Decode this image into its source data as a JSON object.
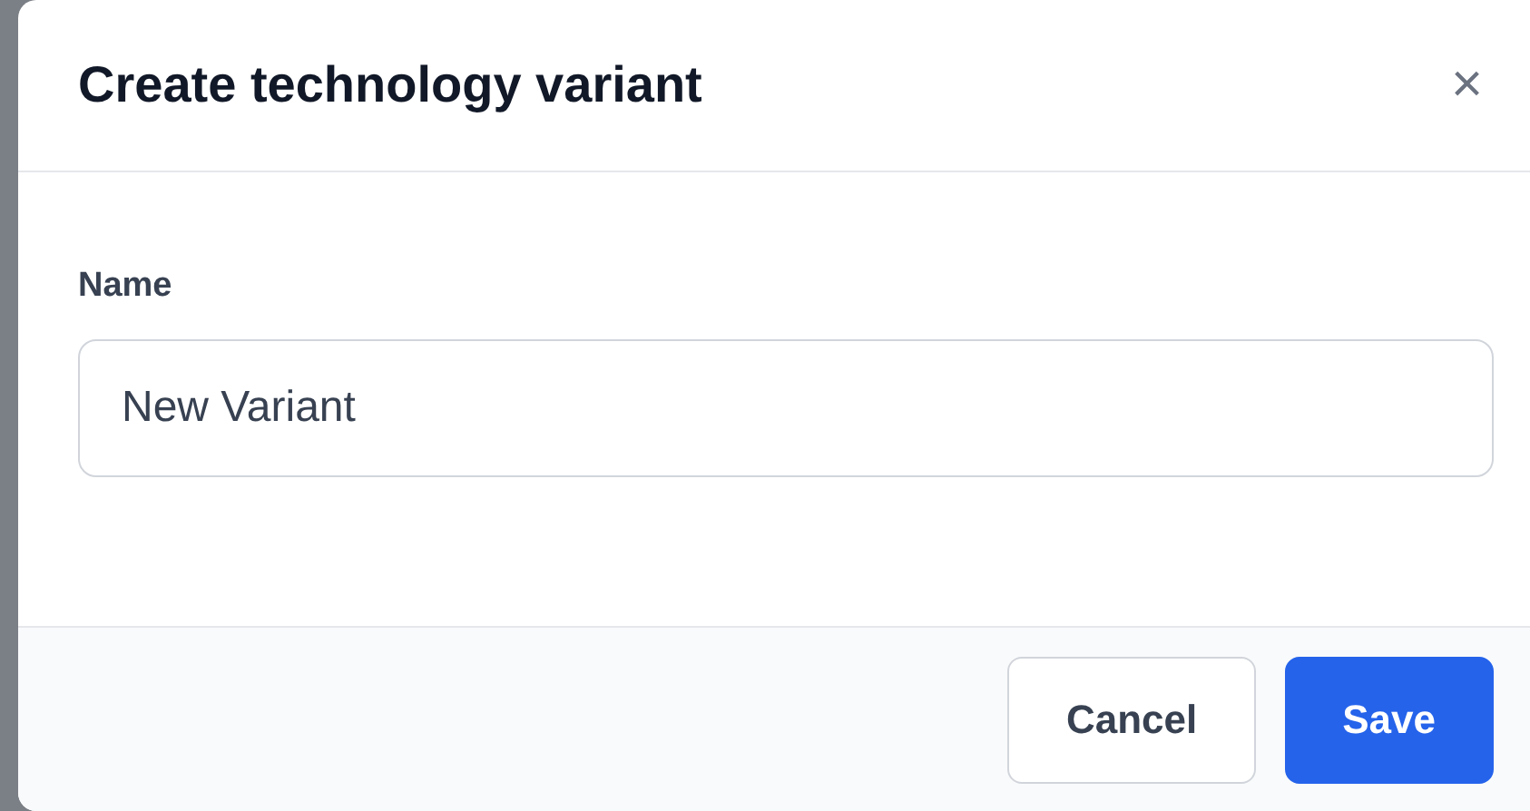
{
  "dialog": {
    "title": "Create technology variant",
    "close": "×"
  },
  "field": {
    "label": "Name",
    "value": "New Variant"
  },
  "buttons": [
    {
      "label": "Cancel",
      "kind": "secondary"
    },
    {
      "label": "Save",
      "kind": "primary"
    }
  ]
}
